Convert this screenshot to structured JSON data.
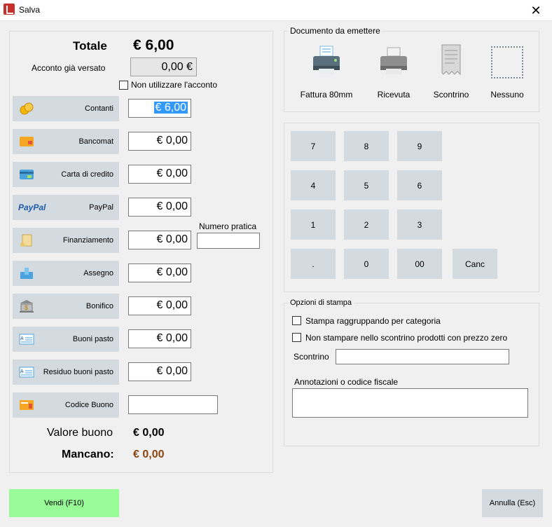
{
  "window": {
    "title": "Salva",
    "close_glyph": "✕"
  },
  "totals": {
    "total_label": "Totale",
    "total_value": "€ 6,00",
    "deposit_label": "Acconto già versato",
    "deposit_value": "0,00 €",
    "no_deposit_label": "Non utilizzare l'acconto",
    "practice_number_label": "Numero pratica",
    "voucher_value_label": "Valore buono",
    "voucher_value": "€ 0,00",
    "missing_label": "Mancano:",
    "missing_value": "€ 0,00"
  },
  "payments": [
    {
      "label": "Contanti",
      "icon": "coins-icon",
      "amount": "€ 6,00"
    },
    {
      "label": "Bancomat",
      "icon": "debit-card-icon",
      "amount": "€ 0,00"
    },
    {
      "label": "Carta di credito",
      "icon": "credit-card-icon",
      "amount": "€ 0,00"
    },
    {
      "label": "PayPal",
      "icon": "paypal-icon",
      "icon_text": "PayPal",
      "amount": "€ 0,00"
    },
    {
      "label": "Finanziamento",
      "icon": "scroll-icon",
      "amount": "€ 0,00"
    },
    {
      "label": "Assegno",
      "icon": "cheque-icon",
      "amount": "€ 0,00"
    },
    {
      "label": "Bonifico",
      "icon": "bank-icon",
      "amount": "€ 0,00"
    },
    {
      "label": "Buoni pasto",
      "icon": "meal-voucher-icon",
      "amount": "€ 0,00"
    },
    {
      "label": "Residuo buoni pasto",
      "icon": "meal-voucher-rest-icon",
      "amount": "€ 0,00"
    },
    {
      "label": "Codice Buono",
      "icon": "voucher-code-icon",
      "amount": ""
    }
  ],
  "document": {
    "legend": "Documento da emettere",
    "options": [
      {
        "label": "Fattura 80mm",
        "icon": "printer-color-icon"
      },
      {
        "label": "Ricevuta",
        "icon": "printer-gray-icon"
      },
      {
        "label": "Scontrino",
        "icon": "receipt-icon"
      },
      {
        "label": "Nessuno",
        "icon": "none-dashed-icon"
      }
    ]
  },
  "keypad": {
    "keys": [
      "7",
      "8",
      "9",
      "4",
      "5",
      "6",
      "1",
      "2",
      "3",
      ".",
      "0",
      "00"
    ],
    "cancel": "Canc"
  },
  "print_options": {
    "legend": "Opzioni di stampa",
    "group_by_category": "Stampa raggruppando per categoria",
    "skip_zero_price": "Non stampare nello scontrino prodotti con prezzo zero",
    "receipt_label": "Scontrino",
    "notes_label": "Annotazioni o codice fiscale"
  },
  "actions": {
    "sell": "Vendi (F10)",
    "cancel": "Annulla (Esc)"
  },
  "colors": {
    "sell_bg": "#98fb98",
    "cancel_bg": "#d4dbe0",
    "button_bg": "#d4dbe0",
    "missing": "#8b4513",
    "selection": "#3399ff"
  }
}
